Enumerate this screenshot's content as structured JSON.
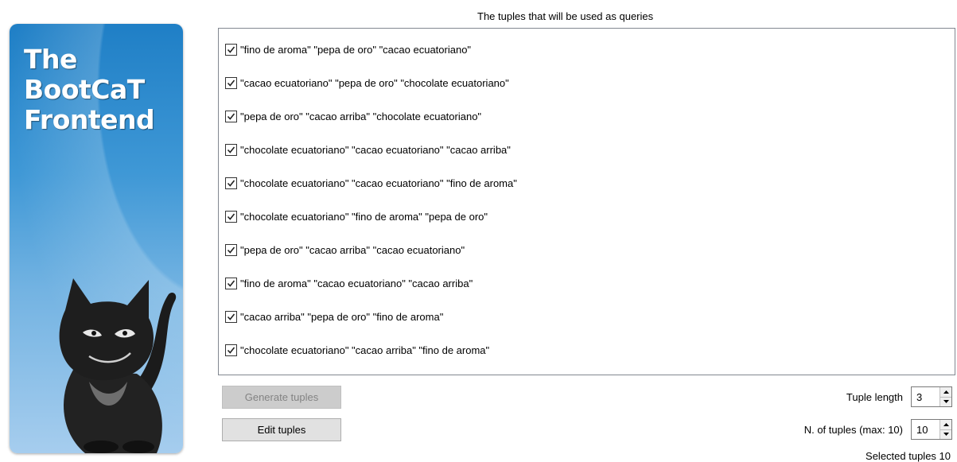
{
  "banner": {
    "title_lines": [
      "The",
      "BootCaT",
      "Frontend"
    ]
  },
  "list": {
    "title": "The tuples that will be used as queries",
    "tuples": [
      {
        "text": "\"fino de aroma\" \"pepa de oro\" \"cacao ecuatoriano\"",
        "checked": true
      },
      {
        "text": "\"cacao ecuatoriano\" \"pepa de oro\" \"chocolate ecuatoriano\"",
        "checked": true
      },
      {
        "text": "\"pepa de oro\" \"cacao arriba\" \"chocolate ecuatoriano\"",
        "checked": true
      },
      {
        "text": "\"chocolate ecuatoriano\" \"cacao ecuatoriano\" \"cacao arriba\"",
        "checked": true
      },
      {
        "text": "\"chocolate ecuatoriano\" \"cacao ecuatoriano\" \"fino de aroma\"",
        "checked": true
      },
      {
        "text": "\"chocolate ecuatoriano\" \"fino de aroma\" \"pepa de oro\"",
        "checked": true
      },
      {
        "text": "\"pepa de oro\" \"cacao arriba\" \"cacao ecuatoriano\"",
        "checked": true
      },
      {
        "text": "\"fino de aroma\" \"cacao ecuatoriano\" \"cacao arriba\"",
        "checked": true
      },
      {
        "text": "\"cacao arriba\" \"pepa de oro\" \"fino de aroma\"",
        "checked": true
      },
      {
        "text": "\"chocolate ecuatoriano\" \"cacao arriba\" \"fino de aroma\"",
        "checked": true
      }
    ]
  },
  "buttons": {
    "generate_label": "Generate tuples",
    "generate_enabled": false,
    "edit_label": "Edit tuples"
  },
  "controls": {
    "tuple_length_label": "Tuple length",
    "tuple_length_value": "3",
    "n_tuples_label": "N. of tuples  (max: 10)",
    "n_tuples_value": "10",
    "selected_label": "Selected tuples  10"
  },
  "icons": {
    "checkbox_check": "check-icon",
    "spin_up": "triangle-up-icon",
    "spin_down": "triangle-down-icon"
  }
}
